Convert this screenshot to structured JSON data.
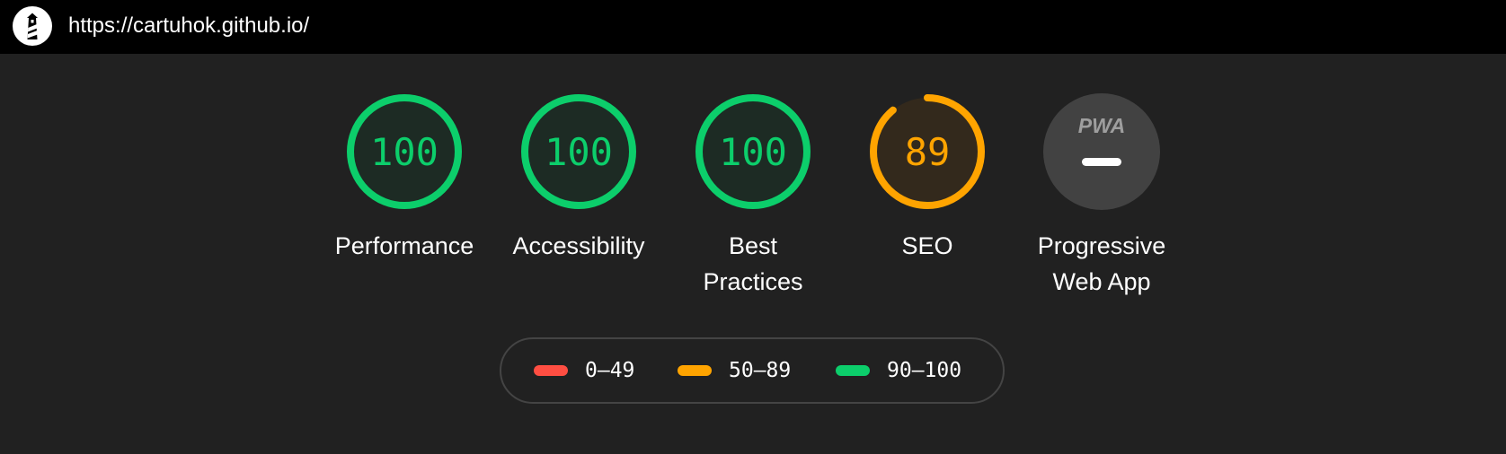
{
  "header": {
    "logo_icon": "lighthouse-icon",
    "url": "https://cartuhok.github.io/"
  },
  "gauges": [
    {
      "label": "Performance",
      "score": "100",
      "value": 100,
      "status": "pass"
    },
    {
      "label": "Accessibility",
      "score": "100",
      "value": 100,
      "status": "pass"
    },
    {
      "label": "Best Practices",
      "score": "100",
      "value": 100,
      "status": "pass"
    },
    {
      "label": "SEO",
      "score": "89",
      "value": 89,
      "status": "average"
    }
  ],
  "pwa": {
    "label": "Progressive Web App",
    "badge_text": "PWA",
    "icon": "pwa-icon"
  },
  "legend": [
    {
      "range": "0–49",
      "status": "fail"
    },
    {
      "range": "50–89",
      "status": "average"
    },
    {
      "range": "90–100",
      "status": "pass"
    }
  ],
  "colors": {
    "pass": "#0CCE6B",
    "average": "#FFA400",
    "fail": "#FF4E42",
    "pass_fill": "#1D2B24",
    "average_fill": "#33291C",
    "pwa_fill": "#424242",
    "background": "#212121",
    "header": "#000000"
  }
}
